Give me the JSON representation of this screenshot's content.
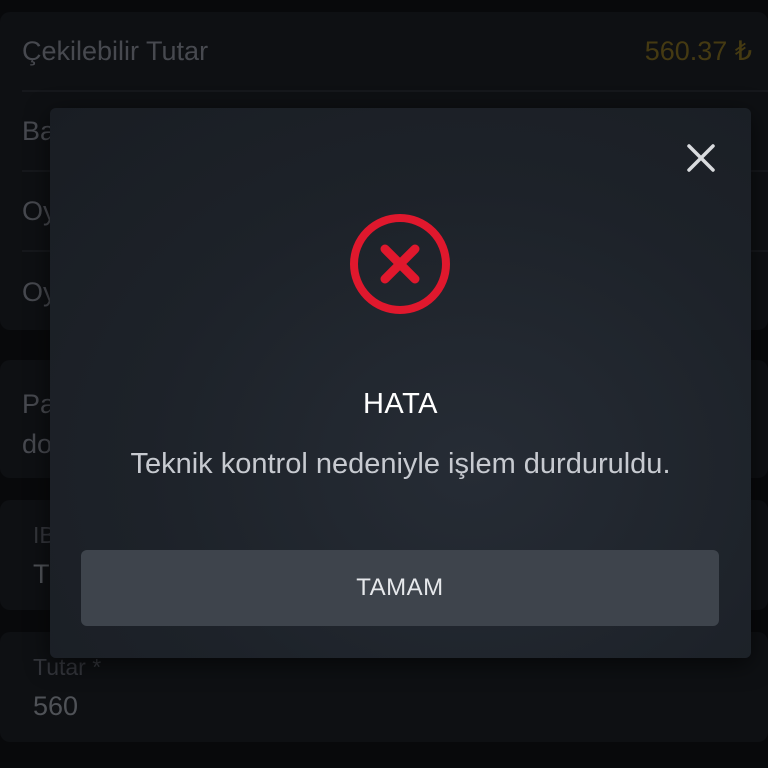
{
  "background": {
    "rows": [
      {
        "label": "Çekilebilir Tutar",
        "value": "560.37 ₺"
      },
      {
        "label": "Ba",
        "value": ""
      },
      {
        "label": "Oy",
        "value": ""
      },
      {
        "label": "Oy",
        "value": ""
      }
    ],
    "note_line1": "Pa",
    "note_line2": "do",
    "iban_label": "IB",
    "iban_value": "T",
    "amount_label": "Tutar *",
    "amount_value": "560"
  },
  "modal": {
    "title": "HATA",
    "message": "Teknik kontrol nedeniyle işlem durduruldu.",
    "button_label": "TAMAM",
    "icons": {
      "close": "close-icon",
      "error": "error-circle-icon"
    },
    "colors": {
      "error": "#e0182d",
      "button": "#3e444c"
    }
  }
}
